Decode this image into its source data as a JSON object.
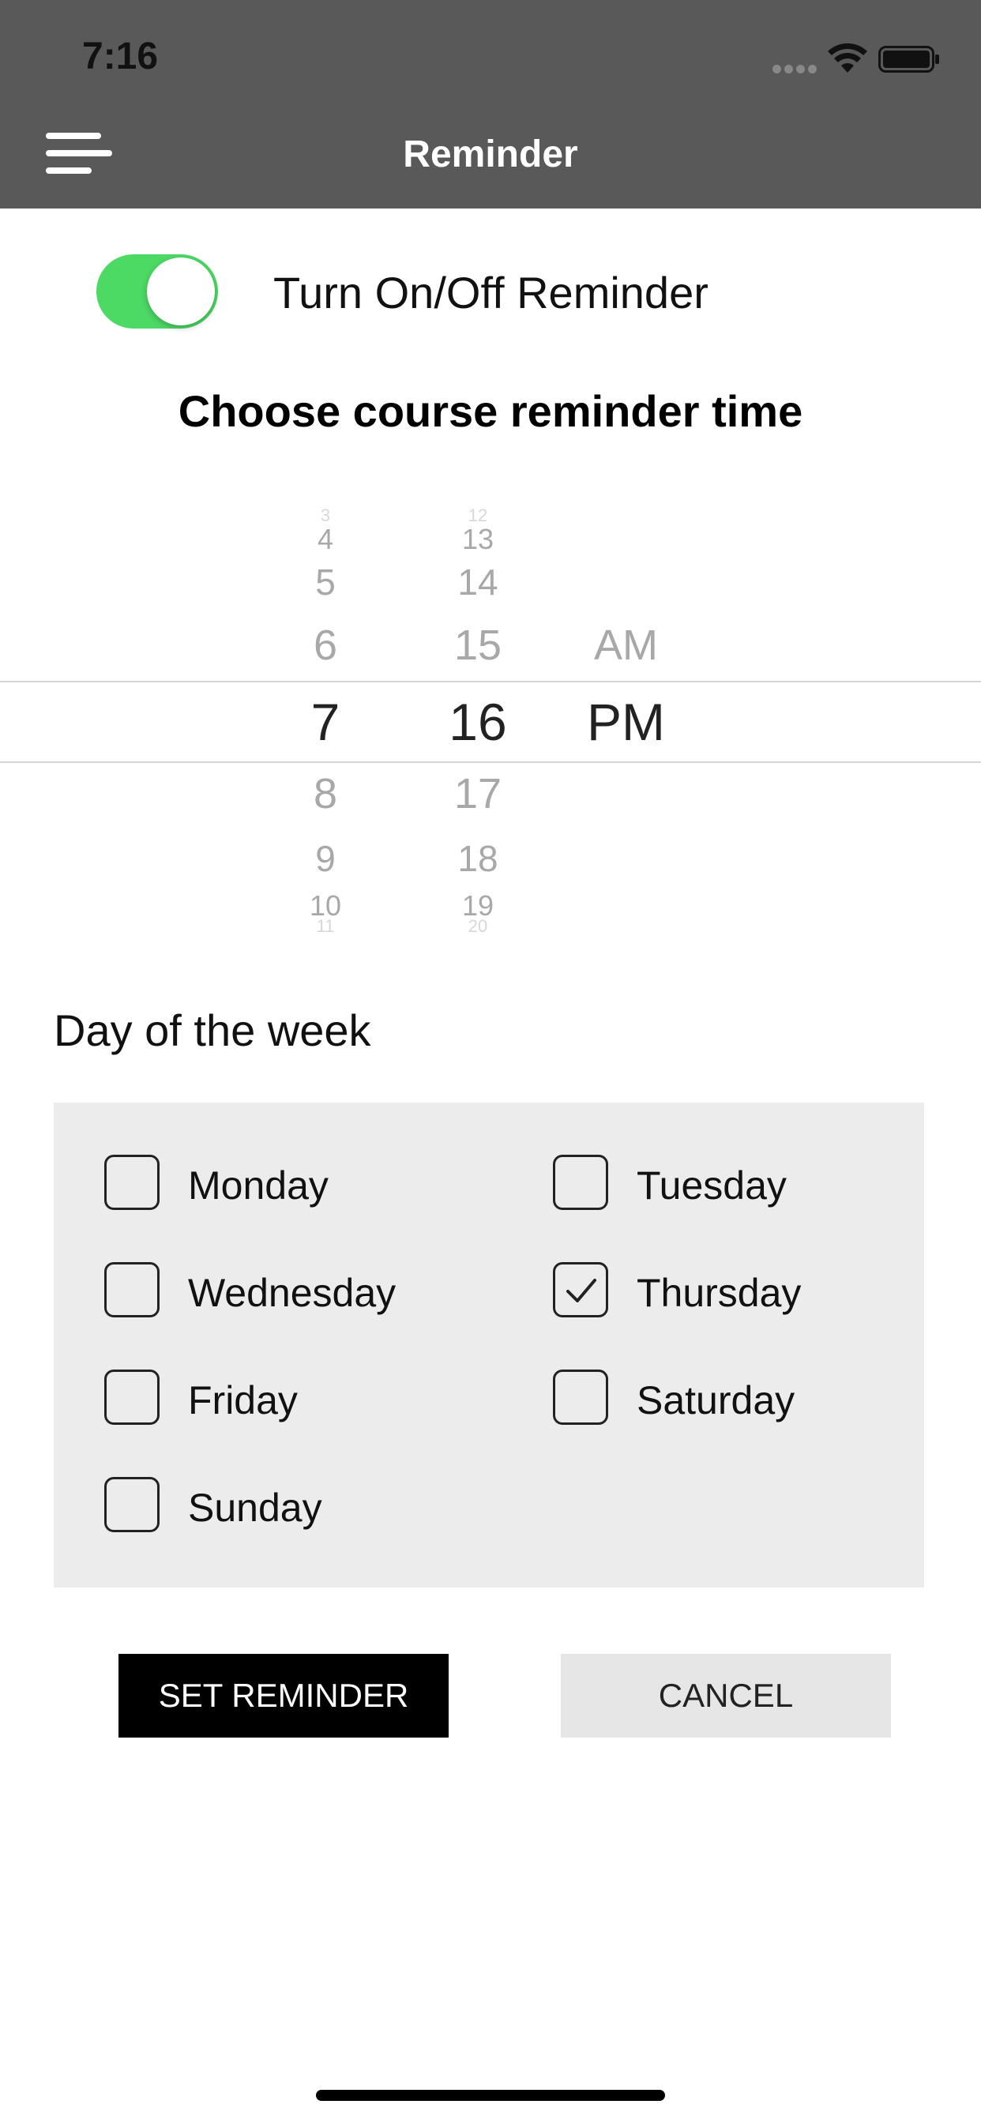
{
  "status_bar": {
    "time": "7:16"
  },
  "header": {
    "title": "Reminder"
  },
  "toggle": {
    "label": "Turn On/Off Reminder",
    "on": true,
    "color": "#4cd964"
  },
  "picker": {
    "heading": "Choose course reminder time",
    "hours": [
      "3",
      "4",
      "5",
      "6",
      "7",
      "8",
      "9",
      "10",
      "11"
    ],
    "minutes": [
      "12",
      "13",
      "14",
      "15",
      "16",
      "17",
      "18",
      "19",
      "20"
    ],
    "meridiem": [
      "AM",
      "PM"
    ],
    "selected_hour": "7",
    "selected_minute": "16",
    "selected_meridiem": "PM"
  },
  "days": {
    "label": "Day of the week",
    "items": [
      {
        "label": "Monday",
        "checked": false
      },
      {
        "label": "Tuesday",
        "checked": false
      },
      {
        "label": "Wednesday",
        "checked": false
      },
      {
        "label": "Thursday",
        "checked": true
      },
      {
        "label": "Friday",
        "checked": false
      },
      {
        "label": "Saturday",
        "checked": false
      },
      {
        "label": "Sunday",
        "checked": false
      }
    ]
  },
  "buttons": {
    "set_label": "SET REMINDER",
    "cancel_label": "CANCEL"
  },
  "colors": {
    "header_bg": "#595959",
    "panel_bg": "#ececec",
    "primary_button": "#000000",
    "secondary_button": "#e6e6e6"
  }
}
